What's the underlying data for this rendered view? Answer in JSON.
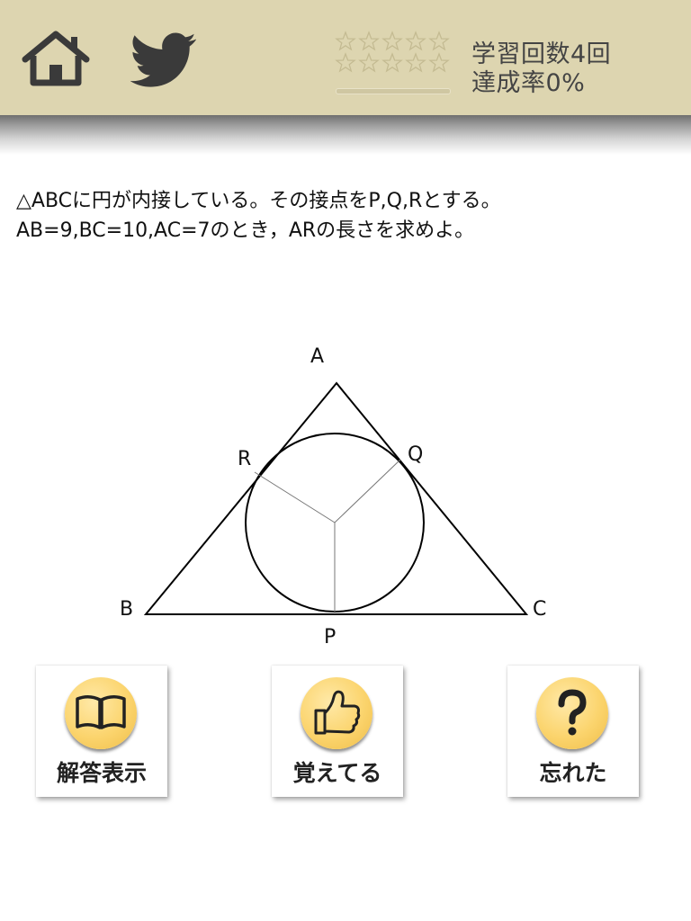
{
  "header": {
    "home_icon": "home-icon",
    "twitter_icon": "twitter-bird-icon",
    "stars_filled": 0,
    "stars_total": 12,
    "progress_fraction": 0,
    "study_count": "学習回数4回",
    "achievement_rate": "達成率0%"
  },
  "question": {
    "line1": "△ABCに円が内接している。その接点をP,Q,Rとする。",
    "line2": "AB=9,BC=10,AC=7のとき，ARの長さを求めよ。"
  },
  "figure": {
    "labels": {
      "a": "A",
      "b": "B",
      "c": "C",
      "p": "P",
      "q": "Q",
      "r": "R"
    }
  },
  "actions": {
    "show_answer": {
      "label": "解答表示",
      "icon": "open-book-icon"
    },
    "remembered": {
      "label": "覚えてる",
      "icon": "thumbs-up-icon"
    },
    "forgot": {
      "label": "忘れた",
      "icon": "question-mark-icon"
    }
  },
  "colors": {
    "header_bg": "#ddd5b0",
    "button_icon_bg": "#fbd46d",
    "text_gray": "#444444"
  }
}
